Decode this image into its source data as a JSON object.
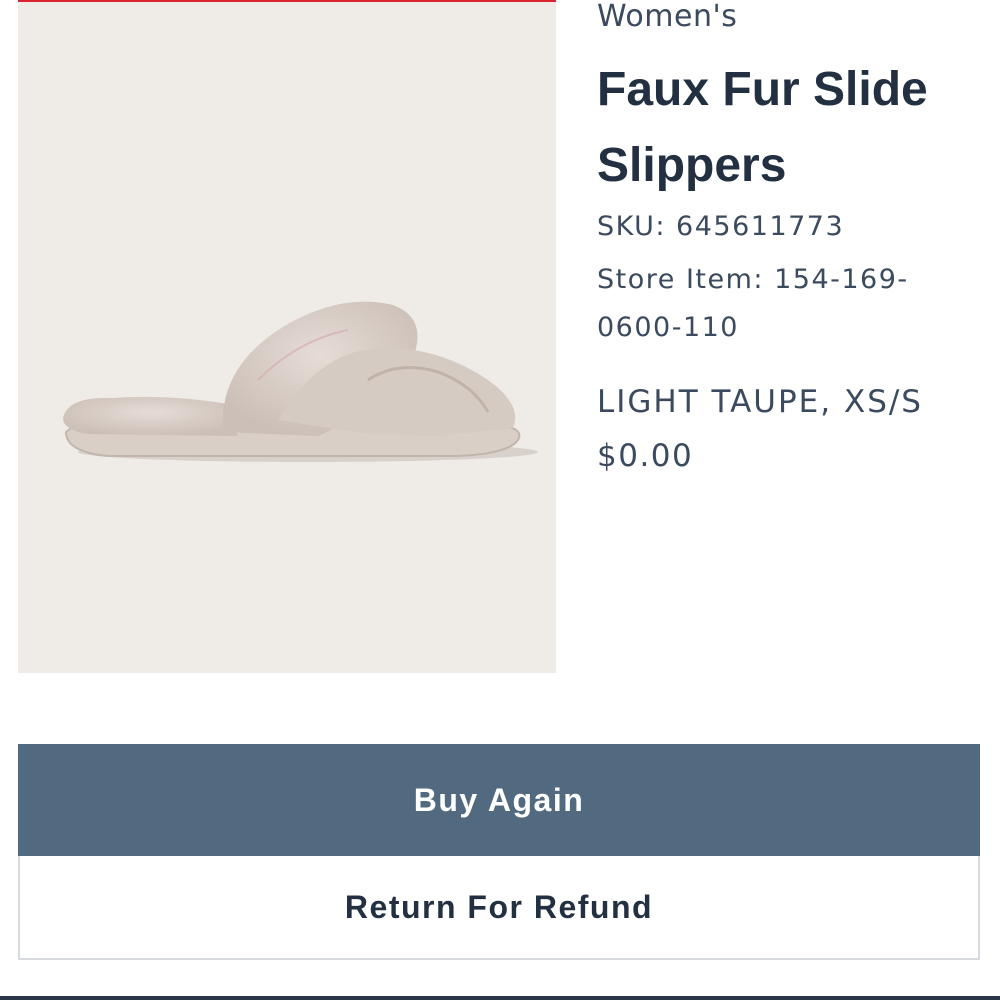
{
  "product": {
    "department": "Women's",
    "name": "Faux Fur Slide Slippers",
    "sku": "SKU: 645611773",
    "store_item": "Store Item: 154-169-0600-110",
    "variant": "LIGHT TAUPE, XS/S",
    "price": "$0.00",
    "image_icon": "slipper-product-image"
  },
  "actions": {
    "buy_again_label": "Buy Again",
    "return_label": "Return For Refund"
  },
  "colors": {
    "primary_button": "#526a80",
    "text": "#233042",
    "accent": "#d9232e"
  }
}
